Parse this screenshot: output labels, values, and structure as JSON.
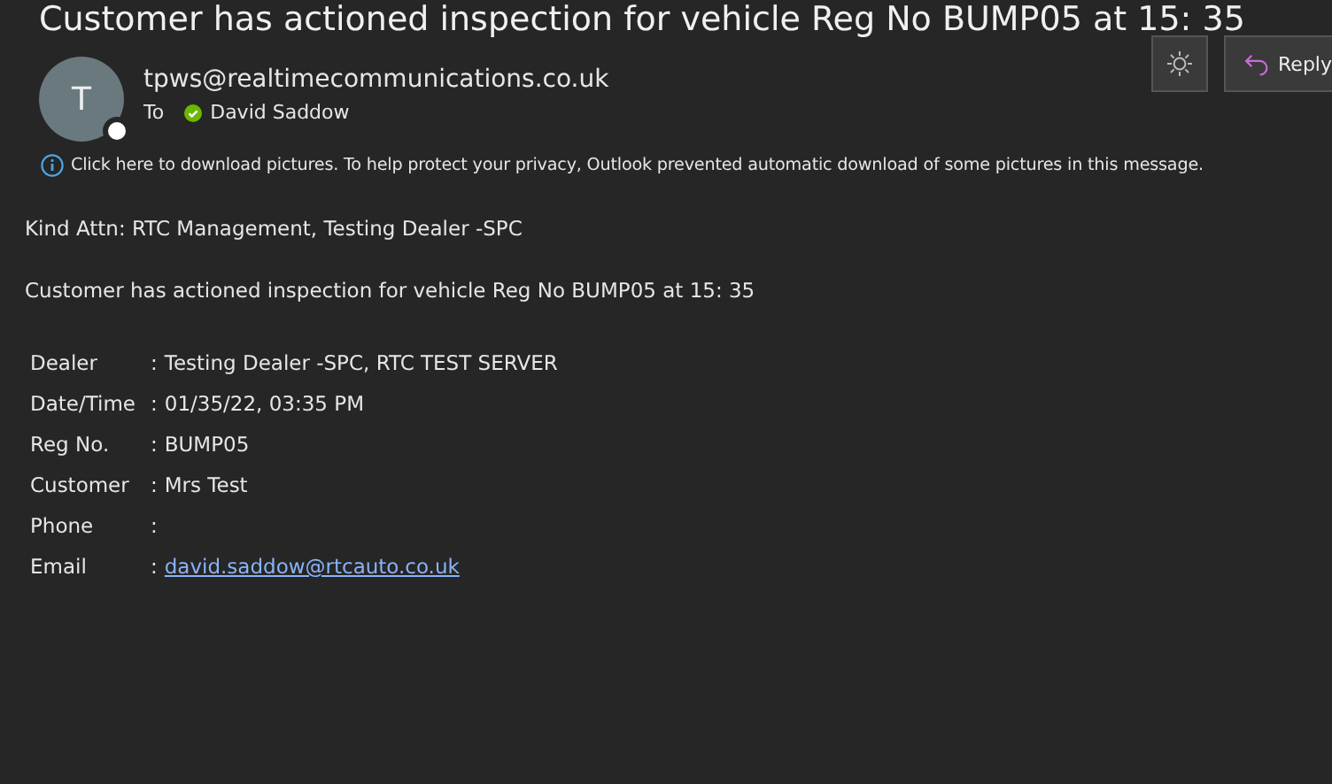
{
  "subject": "Customer has actioned inspection for vehicle Reg No BUMP05 at 15: 35",
  "sender": {
    "initial": "T",
    "address": "tpws@realtimecommunications.co.uk"
  },
  "to": {
    "label": "To",
    "name": "David Saddow",
    "verified": true
  },
  "toolbar": {
    "reply": "Reply"
  },
  "info_bar": "Click here to download pictures. To help protect your privacy, Outlook prevented automatic download of some pictures in this message.",
  "body": {
    "greeting": "Kind Attn: RTC Management, Testing Dealer -SPC",
    "message": "Customer has actioned inspection for vehicle Reg No BUMP05 at 15: 35",
    "details": [
      {
        "label": "Dealer",
        "kind": "text",
        "value": "Testing Dealer -SPC, RTC TEST SERVER"
      },
      {
        "label": "Date/Time",
        "kind": "text",
        "value": "01/35/22, 03:35 PM"
      },
      {
        "label": "Reg No.",
        "kind": "text",
        "value": "BUMP05"
      },
      {
        "label": "Customer",
        "kind": "text",
        "value": "Mrs Test"
      },
      {
        "label": "Phone",
        "kind": "text"
      },
      {
        "label": "Email",
        "kind": "link",
        "value": "david.saddow@rtcauto.co.uk"
      }
    ],
    "separator": ":"
  }
}
